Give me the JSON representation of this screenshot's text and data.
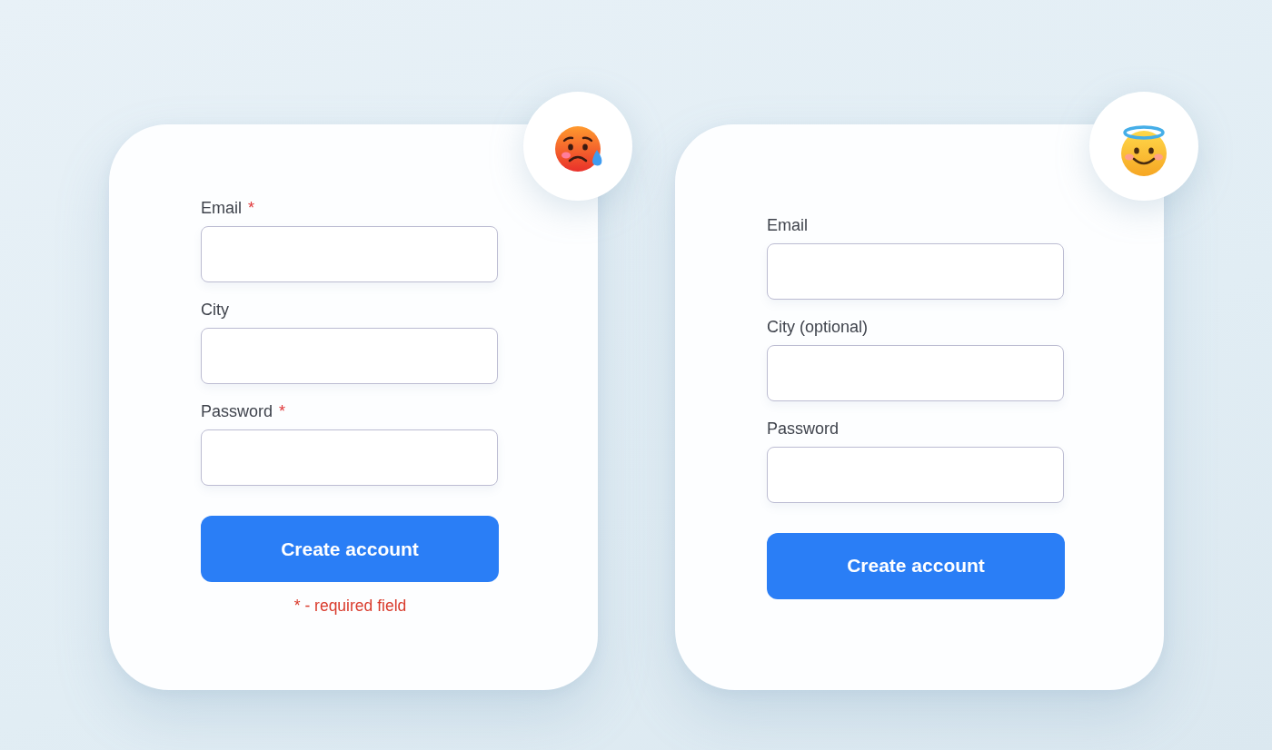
{
  "forms": [
    {
      "kind": "bad",
      "fields": [
        {
          "label": "Email",
          "required_mark": "*"
        },
        {
          "label": "City"
        },
        {
          "label": "Password",
          "required_mark": "*"
        }
      ],
      "button": "Create account",
      "note": "* - required field"
    },
    {
      "kind": "good",
      "fields": [
        {
          "label": "Email"
        },
        {
          "label": "City (optional)"
        },
        {
          "label": "Password"
        }
      ],
      "button": "Create account"
    }
  ]
}
